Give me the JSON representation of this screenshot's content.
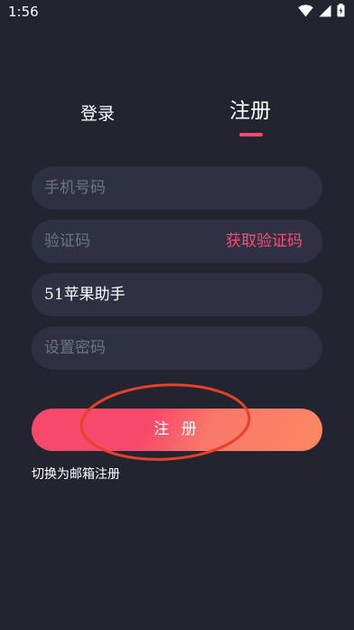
{
  "status_bar": {
    "time": "1:56",
    "icons": [
      "wifi-icon",
      "signal-icon",
      "battery-icon"
    ]
  },
  "tabs": {
    "login": "登录",
    "register": "注册",
    "active": "register"
  },
  "form": {
    "phone_placeholder": "手机号码",
    "code_placeholder": "验证码",
    "get_code_label": "获取验证码",
    "invite_value": "51苹果助手",
    "password_placeholder": "设置密码"
  },
  "actions": {
    "register_label": "注 册",
    "switch_email_label": "切换为邮箱注册"
  },
  "colors": {
    "background": "#22252f",
    "field": "#2e3143",
    "accent": "#ff4a6e",
    "placeholder": "#6d7287",
    "annotation": "#e8402a"
  }
}
